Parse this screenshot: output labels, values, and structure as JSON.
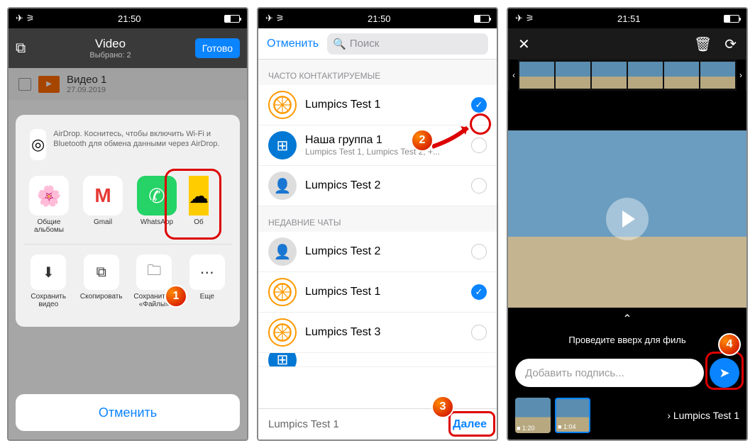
{
  "status": {
    "time1": "21:50",
    "time2": "21:50",
    "time3": "21:51"
  },
  "p1": {
    "title": "Video",
    "subtitle": "Выбрано: 2",
    "done": "Готово",
    "video_name": "Видео 1",
    "video_date": "27.09.2019",
    "airdrop_text": "AirDrop. Коснитесь, чтобы включить Wi-Fi и Bluetooth для обмена данными через AirDrop.",
    "apps": {
      "photos": "Общие альбомы",
      "gmail": "Gmail",
      "whatsapp": "WhatsApp",
      "other": "Об"
    },
    "actions": {
      "save": "Сохранить видео",
      "copy": "Скопировать",
      "savefiles": "Сохранить в «Файлы»",
      "more": "Еще"
    },
    "cancel": "Отменить"
  },
  "p2": {
    "cancel": "Отменить",
    "search_placeholder": "Поиск",
    "section_frequent": "ЧАСТО КОНТАКТИРУЕМЫЕ",
    "section_recent": "НЕДАВНИЕ ЧАТЫ",
    "contacts": {
      "c1": "Lumpics Test 1",
      "c2": "Наша группа 1",
      "c2sub": "Lumpics Test 1, Lumpics Test 2, +...",
      "c3": "Lumpics Test 2",
      "c4": "Lumpics Test 2",
      "c5": "Lumpics Test 1",
      "c6": "Lumpics Test 3"
    },
    "footer_name": "Lumpics Test 1",
    "next": "Далее"
  },
  "p3": {
    "swipe": "Проведите вверх для филь",
    "caption_placeholder": "Добавить подпись...",
    "dur1": "1:20",
    "dur2": "1:04",
    "recipient": "Lumpics Test 1"
  },
  "annot": {
    "n1": "1",
    "n2": "2",
    "n3": "3",
    "n4": "4"
  }
}
